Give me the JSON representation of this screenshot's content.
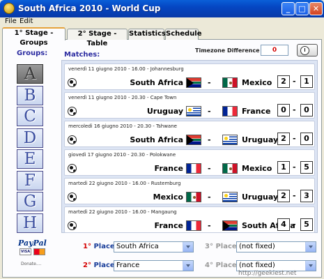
{
  "window": {
    "title": "South Africa 2010 - World Cup"
  },
  "menu": [
    "File",
    "Edit"
  ],
  "tabs": [
    "1° Stage - Groups",
    "2° Stage - Table",
    "Statistics",
    "Schedule"
  ],
  "groups": {
    "label": "Groups:",
    "items": [
      "A",
      "B",
      "C",
      "D",
      "E",
      "F",
      "G",
      "H"
    ],
    "selected": "A"
  },
  "matches_label": "Matches:",
  "timezone": {
    "label": "Timezone Difference (hours):",
    "value": "0"
  },
  "matches": [
    {
      "date": "venerdì 11 giugno 2010 - 16.00 - Johannesburg",
      "home": "South Africa",
      "home_flag": "rsa",
      "away": "Mexico",
      "away_flag": "mex",
      "home_score": "2",
      "away_score": "1"
    },
    {
      "date": "venerdì 11 giugno 2010 - 20.30 - Cape Town",
      "home": "Uruguay",
      "home_flag": "uru",
      "away": "France",
      "away_flag": "fra",
      "home_score": "0",
      "away_score": "0"
    },
    {
      "date": "mercoledì 16 giugno 2010 - 20.30 - Tshwane",
      "home": "South Africa",
      "home_flag": "rsa",
      "away": "Uruguay",
      "away_flag": "uru",
      "home_score": "2",
      "away_score": "0"
    },
    {
      "date": "giovedì 17 giugno 2010 - 20.30 - Polokwane",
      "home": "France",
      "home_flag": "fra",
      "away": "Mexico",
      "away_flag": "mex",
      "home_score": "1",
      "away_score": "5"
    },
    {
      "date": "martedì 22 giugno 2010 - 16.00 - Rustemburg",
      "home": "Mexico",
      "home_flag": "mex",
      "away": "Uruguay",
      "away_flag": "uru",
      "home_score": "2",
      "away_score": "3"
    },
    {
      "date": "martedì 22 giugno 2010 - 16.00 - Mangaung",
      "home": "France",
      "home_flag": "fra",
      "away": "South Africa",
      "away_flag": "rsa",
      "home_score": "4",
      "away_score": "5"
    }
  ],
  "paypal": {
    "logo": "PayPal",
    "visa": "VISA",
    "donate": "Donate...."
  },
  "places": [
    {
      "num": "1°",
      "word": " Place:",
      "value": "South Africa"
    },
    {
      "num": "2°",
      "word": " Place:",
      "value": "France"
    },
    {
      "num": "3°",
      "word": " Place:",
      "value": "(not fixed)"
    },
    {
      "num": "4°",
      "word": " Place:",
      "value": "(not fixed)"
    }
  ],
  "watermark": "http://geekiest.net"
}
